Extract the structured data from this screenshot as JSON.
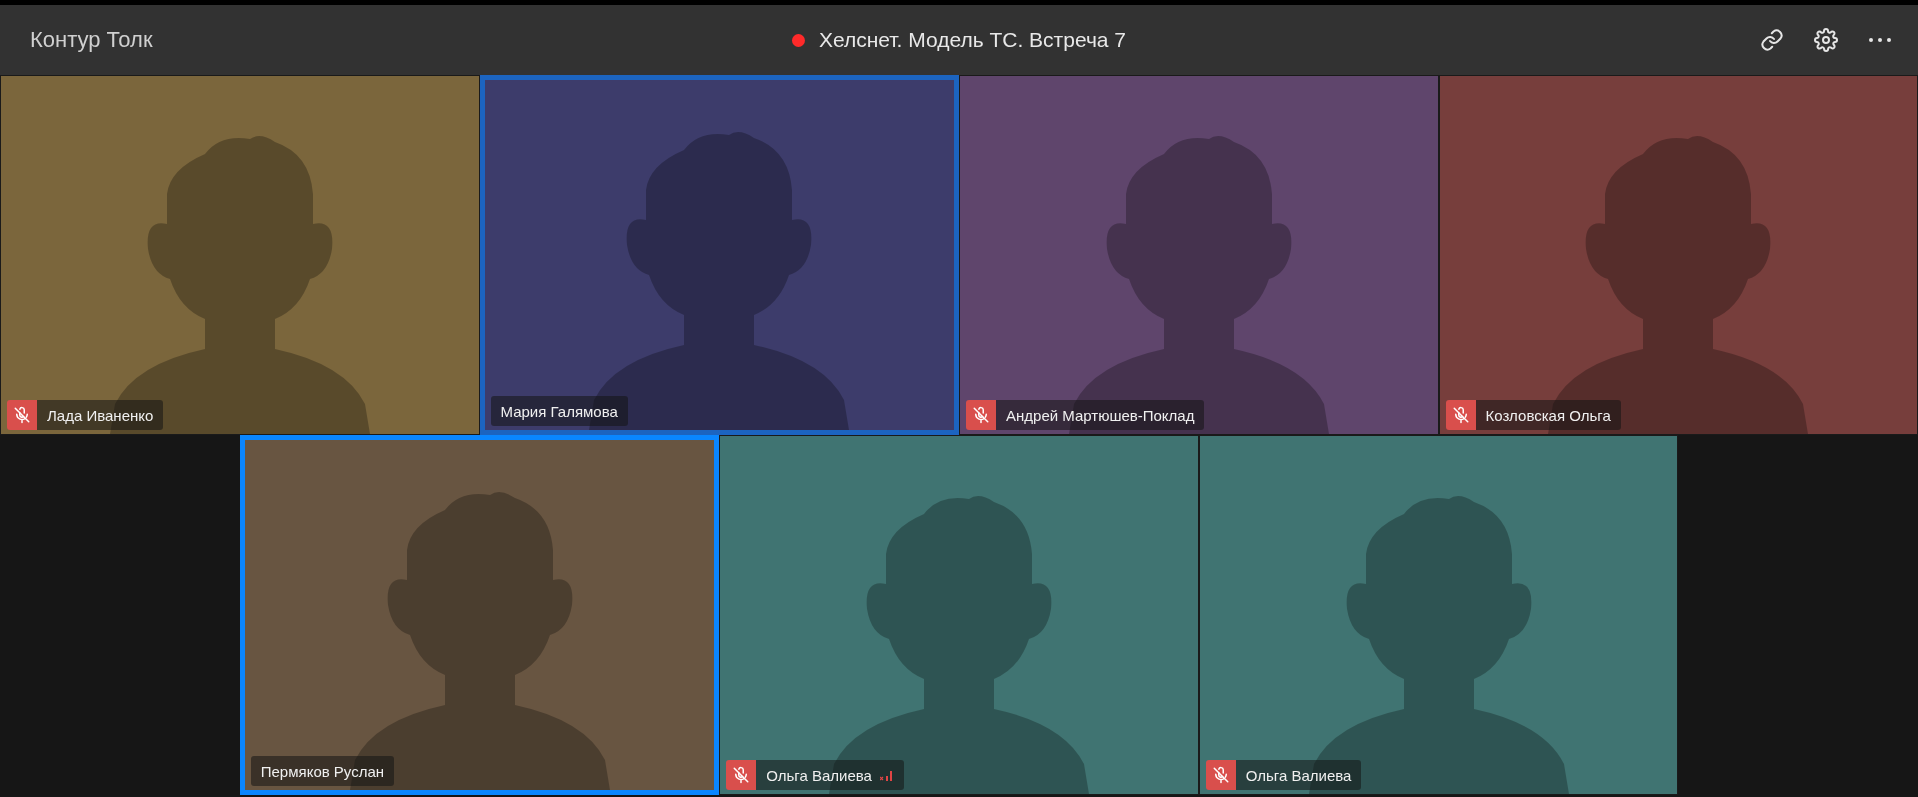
{
  "header": {
    "brand": "Контур Толк",
    "meeting_title": "Хелснет. Модель ТС. Встреча 7",
    "recording": true
  },
  "rows": [
    {
      "tiles": [
        {
          "name": "Лада Иваненко",
          "muted": true,
          "weak_signal": false,
          "speaking": false,
          "pinned": false,
          "color": "#7b663c"
        },
        {
          "name": "Мария Галямова",
          "muted": false,
          "weak_signal": false,
          "speaking": true,
          "pinned": false,
          "color": "#3d3c6b"
        },
        {
          "name": "Андрей Мартюшев-Поклад",
          "muted": true,
          "weak_signal": false,
          "speaking": false,
          "pinned": false,
          "color": "#5f456c"
        },
        {
          "name": "Козловская Ольга",
          "muted": true,
          "weak_signal": false,
          "speaking": false,
          "pinned": false,
          "color": "#773e3c"
        }
      ]
    },
    {
      "tiles": [
        {
          "name": "Пермяков Руслан",
          "muted": false,
          "weak_signal": false,
          "speaking": false,
          "pinned": true,
          "color": "#685541"
        },
        {
          "name": "Ольга Валиева",
          "muted": true,
          "weak_signal": true,
          "speaking": false,
          "pinned": false,
          "color": "#407472"
        },
        {
          "name": "Ольга Валиева",
          "muted": true,
          "weak_signal": false,
          "speaking": false,
          "pinned": false,
          "color": "#407472"
        }
      ]
    }
  ]
}
